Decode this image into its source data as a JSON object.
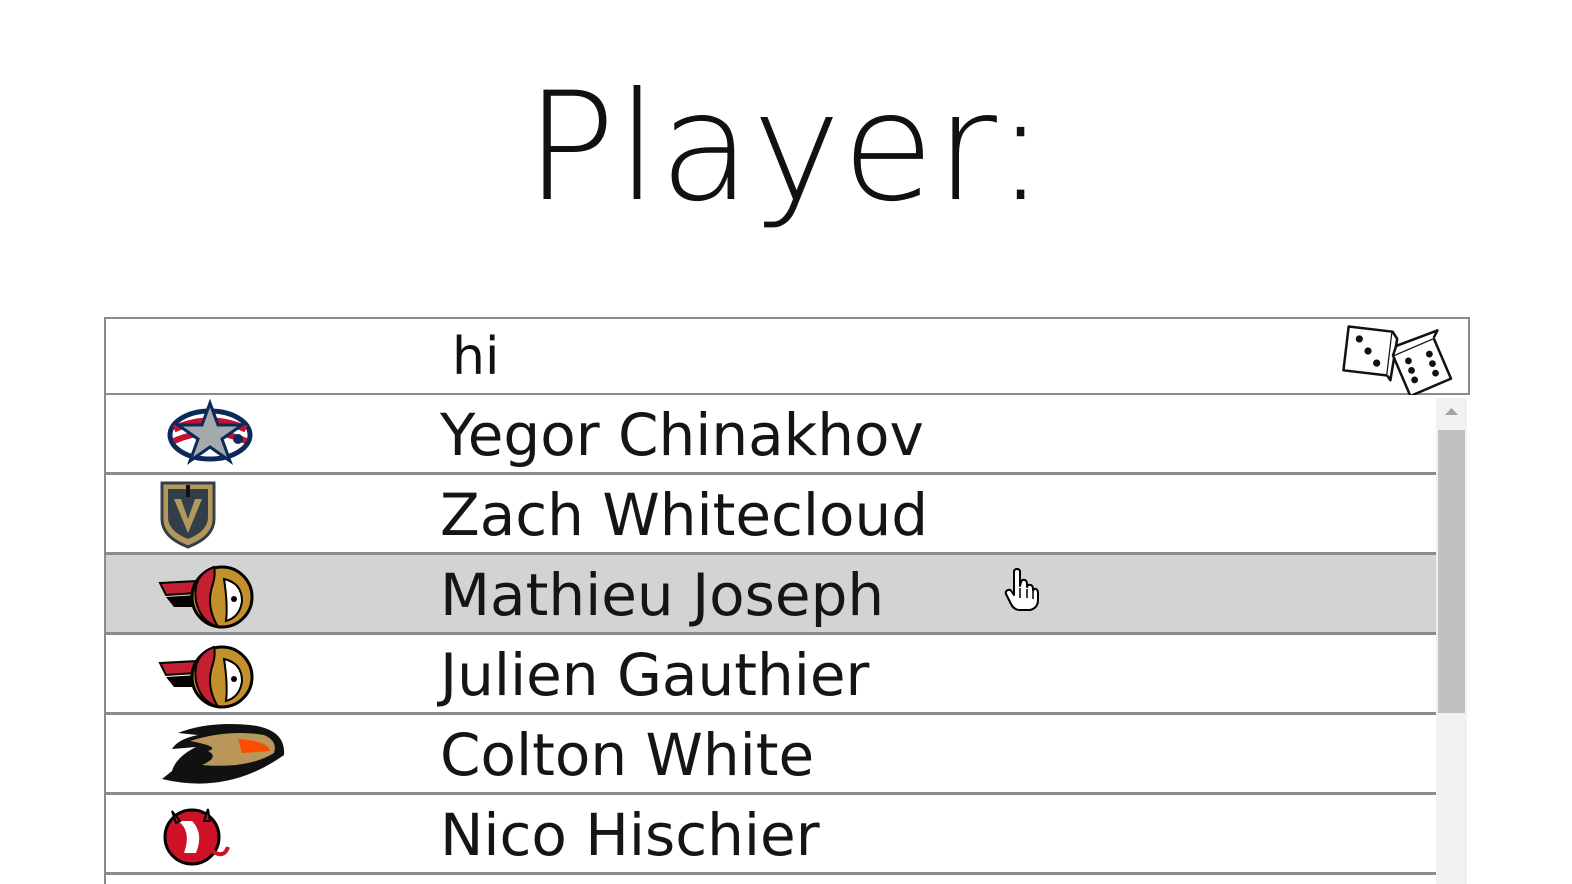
{
  "title": "Player:",
  "search": {
    "value": "hi",
    "random_icon": "dice-icon"
  },
  "results": [
    {
      "name": "Yegor Chinakhov",
      "team_logo": "blue-jackets-logo-icon"
    },
    {
      "name": "Zach Whitecloud",
      "team_logo": "golden-knights-logo-icon"
    },
    {
      "name": "Mathieu Joseph",
      "team_logo": "senators-logo-icon",
      "state": "hovered"
    },
    {
      "name": "Julien Gauthier",
      "team_logo": "senators-logo-icon"
    },
    {
      "name": "Colton White",
      "team_logo": "ducks-logo-icon"
    },
    {
      "name": "Nico Hischier",
      "team_logo": "devils-logo-icon"
    }
  ],
  "colors": {
    "hover_row": "#d3d3d3",
    "row_border": "#8c8c8c",
    "scroll_thumb": "#c1c1c1"
  },
  "cursor_icon": "hand-pointer-icon"
}
